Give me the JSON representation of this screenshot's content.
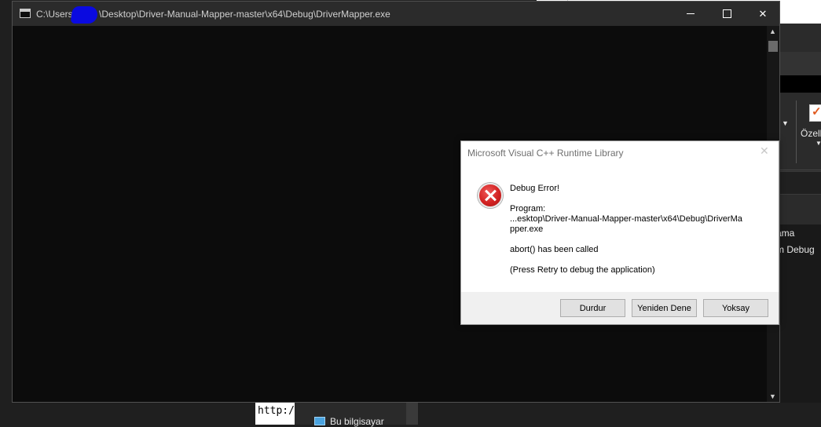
{
  "background": {
    "right_pane": {
      "ribbon_button_label": "Özell",
      "list_row_1": "ama",
      "list_row_2": "m Debug"
    },
    "bottom": {
      "code_text": "http:/",
      "nav_item_label": "Bu bilgisayar"
    }
  },
  "console_window": {
    "title": "C:\\Users\\          \\Desktop\\Driver-Manual-Mapper-master\\x64\\Debug\\DriverMapper.exe",
    "title_prefix": "C:\\Users\\",
    "title_suffix": "\\Desktop\\Driver-Manual-Mapper-master\\x64\\Debug\\DriverMapper.exe",
    "controls": {
      "close_symbol": "✕"
    }
  },
  "error_dialog": {
    "title": "Microsoft Visual C++ Runtime Library",
    "close_symbol": "✕",
    "heading": "Debug Error!",
    "program_label": "Program:",
    "program_path_line1": "...esktop\\Driver-Manual-Mapper-master\\x64\\Debug\\DriverMa",
    "program_path_line2": "pper.exe",
    "message": "abort() has been called",
    "hint": "(Press Retry to debug the application)",
    "buttons": {
      "abort": "Durdur",
      "retry": "Yeniden Dene",
      "ignore": "Yoksay"
    }
  },
  "colors": {
    "console_bg": "#0c0c0c",
    "titlebar_bg": "#2b2b2b",
    "dialog_footer": "#f0f0f0",
    "error_red": "#d22222",
    "redaction_blue": "#0a0ae0"
  }
}
